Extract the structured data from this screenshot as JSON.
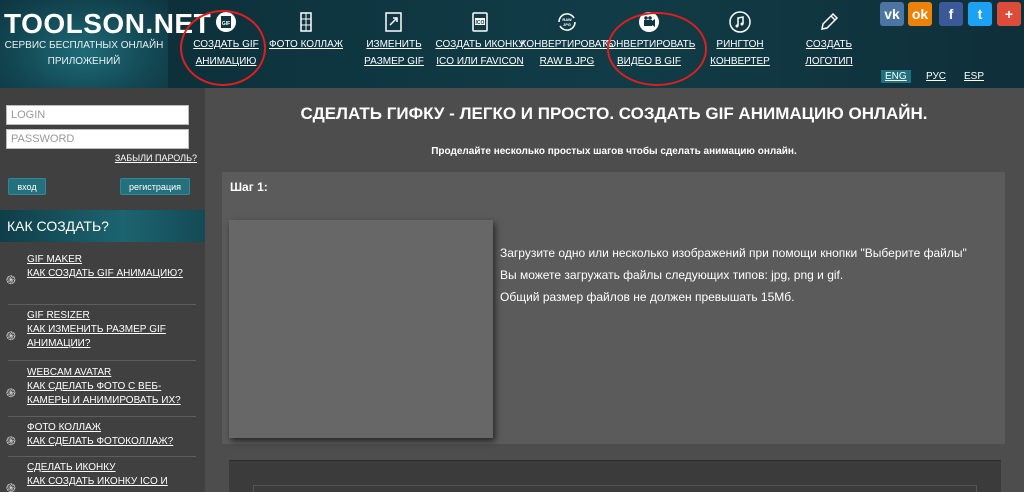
{
  "site": {
    "logo": "TOOLSON.NET",
    "tagline": "СЕРВИС БЕСПЛАТНЫХ ОНЛАЙН ПРИЛОЖЕНИЙ"
  },
  "nav": [
    {
      "line1": "СОЗДАТЬ GIF",
      "line2": "АНИМАЦИЮ",
      "icon": "gif-icon",
      "highlighted": true
    },
    {
      "line1": "ФОТО КОЛЛАЖ",
      "line2": "",
      "icon": "collage-icon",
      "highlighted": false
    },
    {
      "line1": "ИЗМЕНИТЬ",
      "line2": "РАЗМЕР GIF",
      "icon": "resize-icon",
      "highlighted": false
    },
    {
      "line1": "СОЗДАТЬ ИКОНКУ",
      "line2": "ICO ИЛИ FAVICON",
      "icon": "ico-icon",
      "highlighted": false
    },
    {
      "line1": "КОНВЕРТИРОВАТЬ",
      "line2": "RAW В JPG",
      "icon": "raw-icon",
      "highlighted": false
    },
    {
      "line1": "КОНВЕРТИРОВАТЬ",
      "line2": "ВИДЕО В GIF",
      "icon": "video-icon",
      "highlighted": true
    },
    {
      "line1": "РИНГТОН",
      "line2": "КОНВЕРТЕР",
      "icon": "music-icon",
      "highlighted": false
    },
    {
      "line1": "СОЗДАТЬ",
      "line2": "ЛОГОТИП",
      "icon": "pencil-icon",
      "highlighted": false
    }
  ],
  "social": [
    {
      "label": "vk",
      "icon": "vk-icon",
      "color": "#4c75a3"
    },
    {
      "label": "ok",
      "icon": "odnoklassniki-icon",
      "color": "#ee8208"
    },
    {
      "label": "f",
      "icon": "facebook-icon",
      "color": "#3b5998"
    },
    {
      "label": "t",
      "icon": "twitter-icon",
      "color": "#1da1f2"
    },
    {
      "label": "+",
      "icon": "google-plus-icon",
      "color": "#dd4b39"
    }
  ],
  "languages": [
    {
      "label": "ENG",
      "active": true
    },
    {
      "label": "РУС",
      "active": false
    },
    {
      "label": "ESP",
      "active": false
    }
  ],
  "login": {
    "login_placeholder": "LOGIN",
    "password_placeholder": "PASSWORD",
    "forgot": "ЗАБЫЛИ ПАРОЛЬ?",
    "signin": "вход",
    "register": "регистрация"
  },
  "sidebar": {
    "heading": "КАК СОЗДАТЬ?",
    "items": [
      {
        "title": "GIF MAKER",
        "desc": "КАК СОЗДАТЬ GIF АНИМАЦИЮ?"
      },
      {
        "title": "GIF RESIZER",
        "desc": "КАК ИЗМЕНИТЬ РАЗМЕР GIF АНИМАЦИИ?"
      },
      {
        "title": "WEBCAM AVATAR",
        "desc": "КАК СДЕЛАТЬ ФОТО С ВЕБ-КАМЕРЫ И АНИМИРОВАТЬ ИХ?"
      },
      {
        "title": "ФОТО КОЛЛАЖ",
        "desc": "КАК СДЕЛАТЬ ФОТОКОЛЛАЖ?"
      },
      {
        "title": "СДЕЛАТЬ ИКОНКУ",
        "desc": "КАК СОЗДАТЬ ИКОНКУ ICO И"
      }
    ]
  },
  "main": {
    "title": "СДЕЛАТЬ ГИФКУ - ЛЕГКО И ПРОСТО. СОЗДАТЬ GIF АНИМАЦИЮ ОНЛАЙН.",
    "subtitle": "Проделайте несколько простых шагов чтобы сделать анимацию онлайн.",
    "step_label": "Шаг 1:",
    "info": [
      "Загрузите одно или несколько изображений при помощи кнопки \"Выберите файлы\"",
      "Вы можете загружать файлы следующих типов: jpg, png и gif.",
      "Общий размер файлов не должен превышать 15Мб."
    ]
  },
  "colors": {
    "annotation_circle": "#e01e1e",
    "accent": "#24717d"
  }
}
